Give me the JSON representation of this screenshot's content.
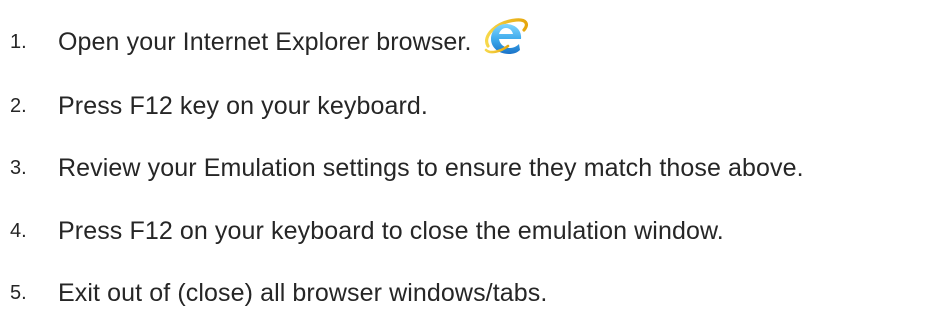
{
  "steps": [
    {
      "number": "1.",
      "text": "Open your Internet Explorer browser.",
      "icon": "internet-explorer-icon"
    },
    {
      "number": "2.",
      "text": "Press F12 key on your keyboard."
    },
    {
      "number": "3.",
      "text": "Review your Emulation settings to ensure they match those above."
    },
    {
      "number": "4.",
      "text": "Press F12 on your keyboard to close the emulation window."
    },
    {
      "number": "5.",
      "text": "Exit out of (close) all browser windows/tabs."
    }
  ],
  "colors": {
    "text": "#262626",
    "ie_blue_light": "#5bc3f5",
    "ie_blue_dark": "#1a7fd0",
    "ie_ring_gold": "#f4c51c"
  }
}
